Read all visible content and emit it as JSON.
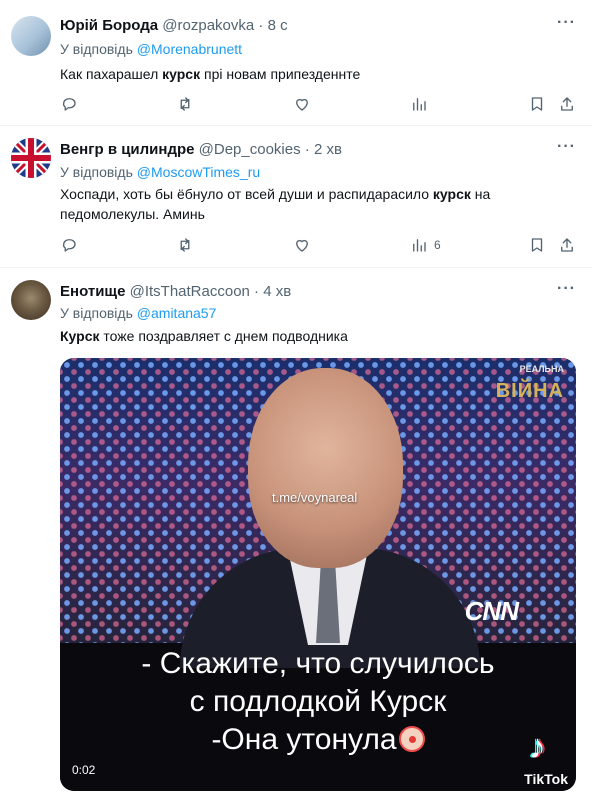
{
  "tweets": [
    {
      "name": "Юрій Борода",
      "handle": "@rozpakovka",
      "time": "· 8 с",
      "reply_prefix": "У відповідь",
      "reply_to": "@Morenabrunett",
      "text_before": "Как пахарашел ",
      "text_bold": "курск",
      "text_after": " прі новам припезденнте",
      "views": ""
    },
    {
      "name": "Венгр в цилиндре",
      "handle": "@Dep_cookies",
      "time": "· 2 хв",
      "reply_prefix": "У відповідь",
      "reply_to": "@MoscowTimes_ru",
      "text_before": "Хоспади, хоть  бы ёбнуло от всей души и распидарасило ",
      "text_bold": "курск",
      "text_after": " на педомолекулы. Аминь",
      "views": "6"
    },
    {
      "name": "Енотище",
      "handle": "@ItsThatRaccoon",
      "time": "· 4 хв",
      "reply_prefix": "У відповідь",
      "reply_to": "@amitana57",
      "text_bold": "Курск",
      "text_after": " тоже поздравляет с днем подводника"
    }
  ],
  "video": {
    "watermark": "t.me/voynareal",
    "brand_small": "РЕАЛЬНА",
    "brand_big": "ВІЙНА",
    "network": "CNN",
    "subtitle_1": "- Скажите, что случилось",
    "subtitle_2": "с подлодкой Курск",
    "subtitle_3": "-Она утонула",
    "time": "0:02",
    "tiktok_label": "TikTok"
  },
  "icons": {
    "more": "more-dots-icon",
    "reply": "reply-icon",
    "retweet": "retweet-icon",
    "like": "like-icon",
    "views": "views-icon",
    "bookmark": "bookmark-icon",
    "share": "share-icon",
    "emoji": "clown-face-emoji"
  },
  "colors": {
    "link": "#1d9bf0",
    "secondary": "#536471",
    "text": "#0f1419"
  }
}
